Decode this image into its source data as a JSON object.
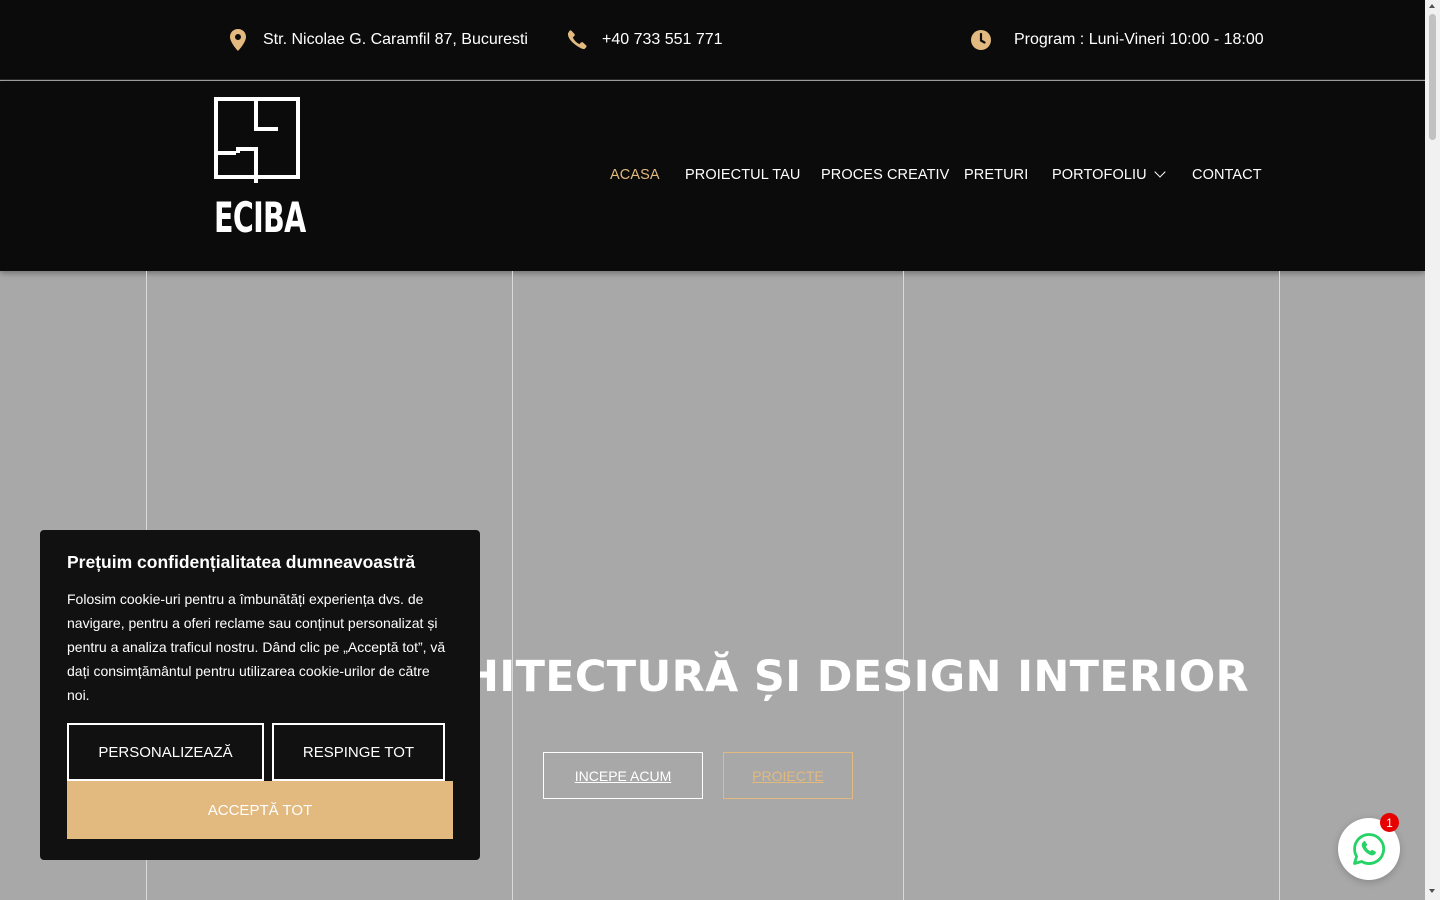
{
  "topbar": {
    "address": "Str. Nicolae G. Caramfil 87, Bucuresti",
    "phone": "+40 733 551 771",
    "hours": "Program : Luni-Vineri 10:00 - 18:00"
  },
  "brand": {
    "logo_text": "ECIBA"
  },
  "nav": {
    "items": [
      {
        "label": "ACASA",
        "active": true
      },
      {
        "label": "PROIECTUL TAU"
      },
      {
        "label": "PROCES CREATIV"
      },
      {
        "label": "PRETURI"
      },
      {
        "label": "PORTOFOLIU"
      },
      {
        "label": "CONTACT"
      }
    ]
  },
  "hero": {
    "title": "ARHITECTURĂ ȘI DESIGN INTERIOR",
    "primary_button": "INCEPE ACUM",
    "secondary_button": "PROIECTE"
  },
  "cookie": {
    "title": "Prețuim confidențialitatea dumneavoastră",
    "body": "Folosim cookie-uri pentru a îmbunătăți experiența dvs. de navigare, pentru a oferi reclame sau conținut personalizat și pentru a analiza traficul nostru. Dând clic pe „Acceptă tot”, vă dați consimțământul pentru utilizarea cookie-urilor de către noi.",
    "customize": "PERSONALIZEAZĂ",
    "reject": "RESPINGE TOT",
    "accept": "ACCEPTĂ TOT"
  },
  "whatsapp": {
    "badge_count": "1"
  },
  "colors": {
    "accent": "#e2b97f",
    "dark": "#0b0b0b",
    "hero_bg": "#a8a8a8",
    "badge": "#e60000",
    "whatsapp_green": "#25d366"
  }
}
